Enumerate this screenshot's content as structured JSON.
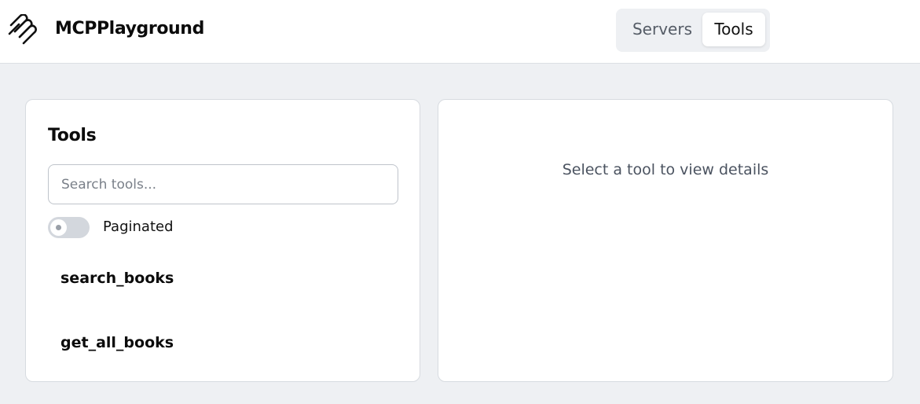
{
  "app": {
    "title": "MCPPlayground",
    "logo_icon": "paperclip-stack-icon"
  },
  "nav": {
    "tabs": [
      {
        "label": "Servers",
        "active": false
      },
      {
        "label": "Tools",
        "active": true
      }
    ]
  },
  "tools_panel": {
    "title": "Tools",
    "search": {
      "placeholder": "Search tools...",
      "value": ""
    },
    "paginated": {
      "label": "Paginated",
      "enabled": false
    },
    "items": [
      {
        "name": "search_books"
      },
      {
        "name": "get_all_books"
      }
    ]
  },
  "details_panel": {
    "empty_message": "Select a tool to view details"
  },
  "colors": {
    "background": "#eef0f3",
    "surface": "#ffffff",
    "border": "#d7dbe0",
    "toggle_off": "#d3d7dd",
    "muted_text": "#4b5360"
  }
}
